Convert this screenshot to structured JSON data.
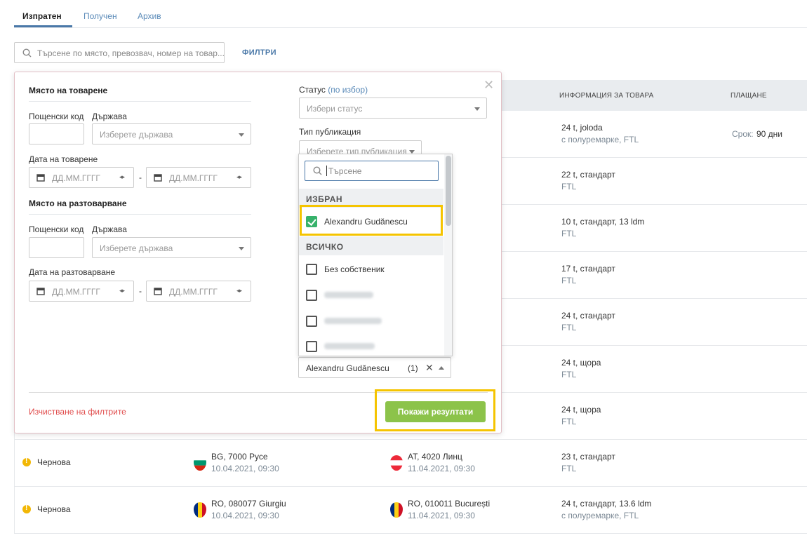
{
  "tabs": [
    {
      "label": "Изпратен",
      "active": true
    },
    {
      "label": "Получен",
      "active": false
    },
    {
      "label": "Архив",
      "active": false
    }
  ],
  "search": {
    "placeholder": "Търсене по място, превозвач, номер на товар..."
  },
  "filters_link": "ФИЛТРИ",
  "table": {
    "headers": {
      "cargo_info": "ИНФОРМАЦИЯ ЗА ТОВАРА",
      "payment": "ПЛАЩАНЕ"
    },
    "rows": [
      {
        "cargo": "24 t, joloda",
        "cargo_sub": "с полуремарке, FTL",
        "payment_label": "Срок:",
        "payment_value": "90 дни"
      },
      {
        "cargo": "22 t, стандарт",
        "cargo_sub": "FTL"
      },
      {
        "cargo": "10 t, стандарт, 13 ldm",
        "cargo_sub": "FTL"
      },
      {
        "cargo": "17 t, стандарт",
        "cargo_sub": "FTL"
      },
      {
        "cargo": "24 t, стандарт",
        "cargo_sub": "FTL"
      },
      {
        "cargo": "24 t, щора",
        "cargo_sub": "FTL"
      },
      {
        "cargo": "24 t, щора",
        "cargo_sub": "FTL"
      },
      {
        "status": "Чернова",
        "from": "BG, 7000 Русе",
        "from_date": "10.04.2021, 09:30",
        "to": "AT, 4020 Линц",
        "to_date": "11.04.2021, 09:30",
        "cargo": "23 t, стандарт",
        "cargo_sub": "FTL"
      },
      {
        "status": "Чернова",
        "from": "RO, 080077 Giurgiu",
        "from_date": "10.04.2021, 09:30",
        "to": "RO, 010011 București",
        "to_date": "11.04.2021, 09:30",
        "cargo": "24 t, стандарт, 13.6 ldm",
        "cargo_sub": "с полуремарке, FTL"
      }
    ]
  },
  "filter_panel": {
    "loading": {
      "title": "Място на товарене",
      "postcode_label": "Пощенски код",
      "country_label": "Държава",
      "country_placeholder": "Изберете държава",
      "date_label": "Дата на товарене",
      "date_placeholder": "ДД.ММ.ГГГГ"
    },
    "unloading": {
      "title": "Място на разтоварване",
      "postcode_label": "Пощенски код",
      "country_label": "Държава",
      "country_placeholder": "Изберете държава",
      "date_label": "Дата на разтоварване",
      "date_placeholder": "ДД.ММ.ГГГГ"
    },
    "status_label": "Статус",
    "status_optional": "(по избор)",
    "status_placeholder": "Избери статус",
    "publication_label": "Тип публикация",
    "publication_placeholder": "Изберете тип публикация",
    "owner_dropdown": {
      "search_placeholder": "Търсене",
      "selected_group": "ИЗБРАН",
      "all_group": "ВСИЧКО",
      "selected_items": [
        {
          "label": "Alexandru Gudănescu",
          "checked": true
        }
      ],
      "all_items": [
        {
          "label": "Без собственик",
          "checked": false
        }
      ]
    },
    "owner_select": {
      "value": "Alexandru Gudănescu",
      "count": "(1)"
    },
    "clear_label": "Изчистване на филтрите",
    "show_results_label": "Покажи резултати"
  },
  "colors": {
    "accent": "#4a78a8",
    "green": "#8cc34a",
    "highlight": "#f5c400",
    "danger": "#e04b4b"
  }
}
